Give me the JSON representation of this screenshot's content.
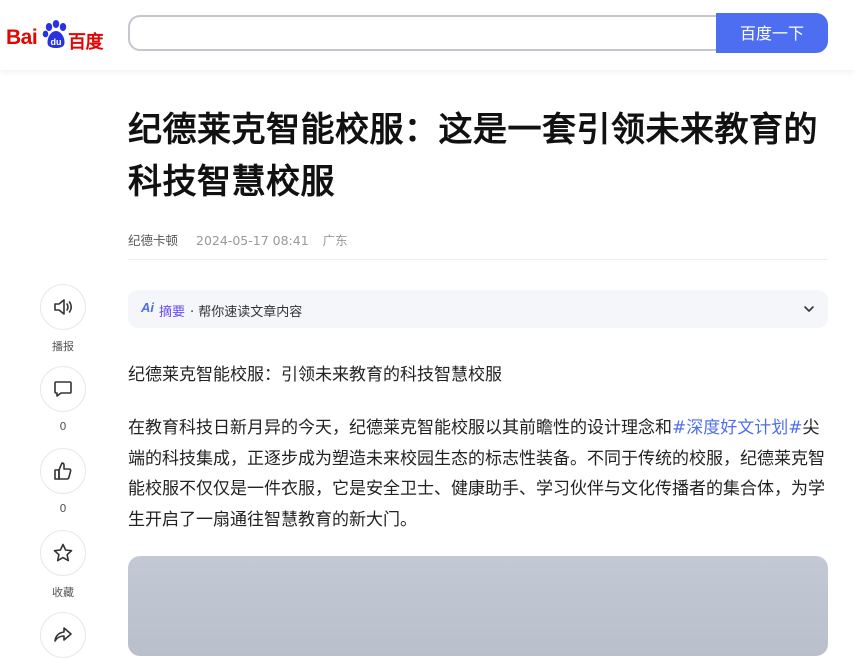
{
  "header": {
    "logo_left": "Bai",
    "logo_right": "百度",
    "search_value": "",
    "search_button": "百度一下"
  },
  "article": {
    "title": "纪德莱克智能校服：这是一套引领未来教育的科技智慧校服",
    "author": "纪德卡顿",
    "time": "2024-05-17 08:41",
    "location": "广东",
    "ai_badge": "Ai",
    "ai_label": "摘要",
    "ai_desc": "· 帮你速读文章内容",
    "para1": "纪德莱克智能校服：引领未来教育的科技智慧校服",
    "para2_a": "在教育科技日新月异的今天，纪德莱克智能校服以其前瞻性的设计理念和",
    "hashtag": "#深度好文计划#",
    "para2_b": "尖端的科技集成，正逐步成为塑造未来校园生态的标志性装备。不同于传统的校服，纪德莱克智能校服不仅仅是一件衣服，它是安全卫士、健康助手、学习伙伴与文化传播者的集合体，为学生开启了一扇通往智慧教育的新大门。"
  },
  "sidebar": {
    "items": [
      {
        "icon": "speaker-icon",
        "label": "播报"
      },
      {
        "icon": "comment-icon",
        "label": "0"
      },
      {
        "icon": "thumbs-up-icon",
        "label": "0"
      },
      {
        "icon": "star-icon",
        "label": "收藏"
      }
    ]
  },
  "colors": {
    "brand_red": "#e10602",
    "brand_blue": "#4e6ef2",
    "ai_purple": "#6a4cf2"
  }
}
